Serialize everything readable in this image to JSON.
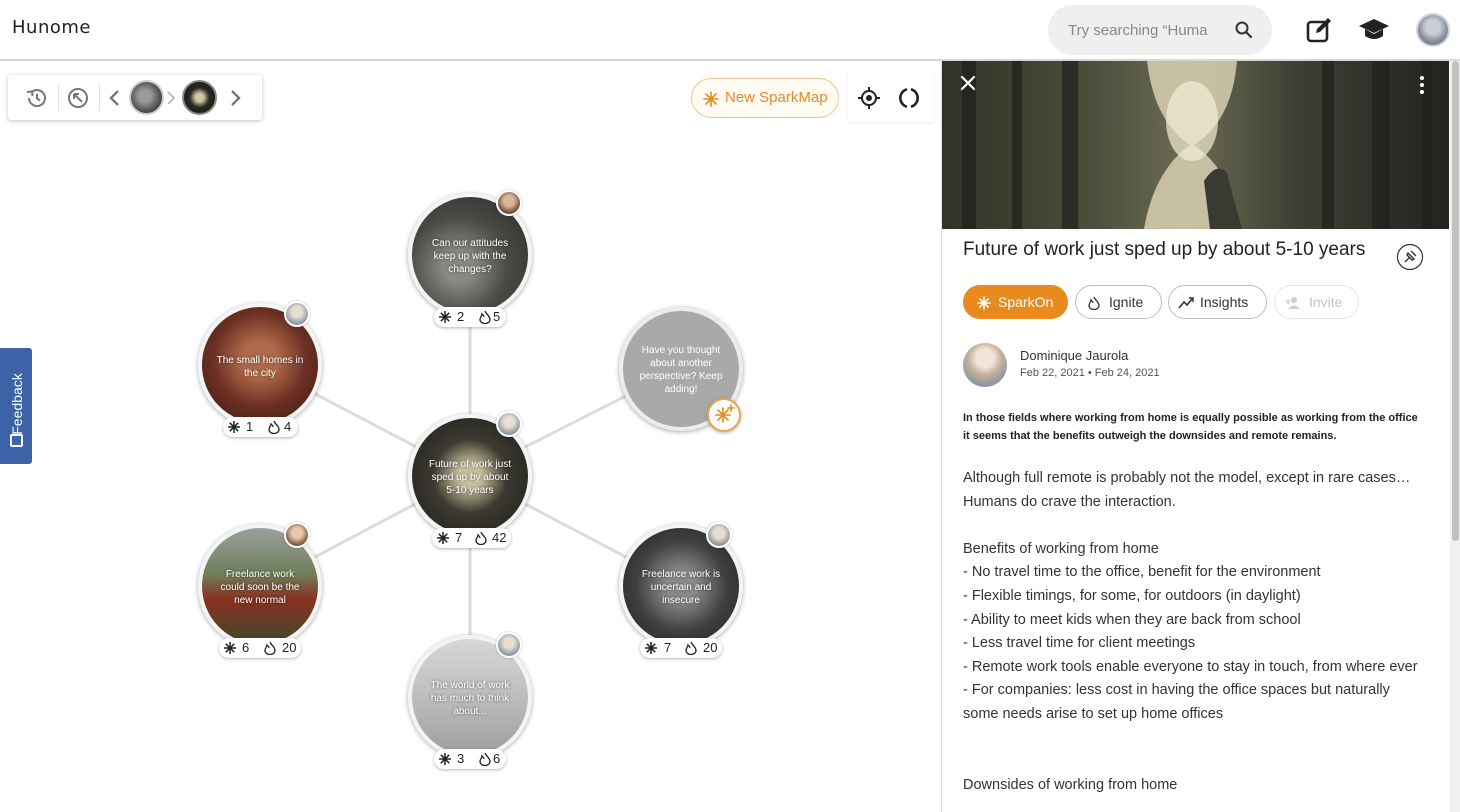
{
  "app": {
    "logo": "Hunome",
    "search_placeholder": "Try searching “Huma",
    "icons": [
      "search-icon",
      "edit-icon",
      "graduation-cap-icon",
      "user-avatar"
    ]
  },
  "history_toolbar": {
    "icons": [
      "history-icon",
      "recenter-icon",
      "chevron-left-icon",
      "chevron-right-icon"
    ]
  },
  "actions": {
    "new_sparkmap": "New SparkMap"
  },
  "feedback": {
    "label": "Feedback"
  },
  "map": {
    "center": {
      "text": "Future of work just sped up by about 5-10 years",
      "sparks": "7",
      "ignites": "42"
    },
    "top": {
      "text": "Can our attitudes keep up with the changes?",
      "sparks": "2",
      "ignites": "5"
    },
    "upper_left": {
      "text": "The small homes in the city",
      "sparks": "1",
      "ignites": "4"
    },
    "upper_right": {
      "text": "Have you thought about another perspective? Keep adding!"
    },
    "lower_left": {
      "text": "Freelance work could soon be the new normal",
      "sparks": "6",
      "ignites": "20"
    },
    "lower_right": {
      "text": "Freelance work is uncertain and insecure",
      "sparks": "7",
      "ignites": "20"
    },
    "bottom": {
      "text": "The world of work has much to think about...",
      "sparks": "3",
      "ignites": "6"
    }
  },
  "panel": {
    "title": "Future of work just sped up by about 5-10 years",
    "buttons": {
      "sparkon": "SparkOn",
      "ignite": "Ignite",
      "insights": "Insights",
      "invite": "Invite"
    },
    "author": "Dominique Jaurola",
    "dates": "Feb 22, 2021  • Feb 24, 2021",
    "summary": "In those fields where working from home is equally possible as working from the office it seems that the benefits outweigh the downsides and remote remains.",
    "body": [
      "Although full remote is probably not the model, except in rare cases… Humans do crave the interaction.",
      "",
      "Benefits of working from home",
      "- No travel time to the office, benefit for the environment",
      "- Flexible timings, for some, for outdoors (in daylight)",
      "- Ability to meet kids when they are back from school",
      "- Less travel time for client meetings",
      "- Remote work tools enable everyone to stay in touch, from where ever",
      "- For companies: less cost in having the office spaces but naturally some needs arise to set up home offices",
      "",
      "",
      "Downsides of working from home"
    ]
  },
  "colors": {
    "accent": "#e98a1e",
    "feedback": "#3d62a8",
    "connector": "#dcdcdc"
  }
}
